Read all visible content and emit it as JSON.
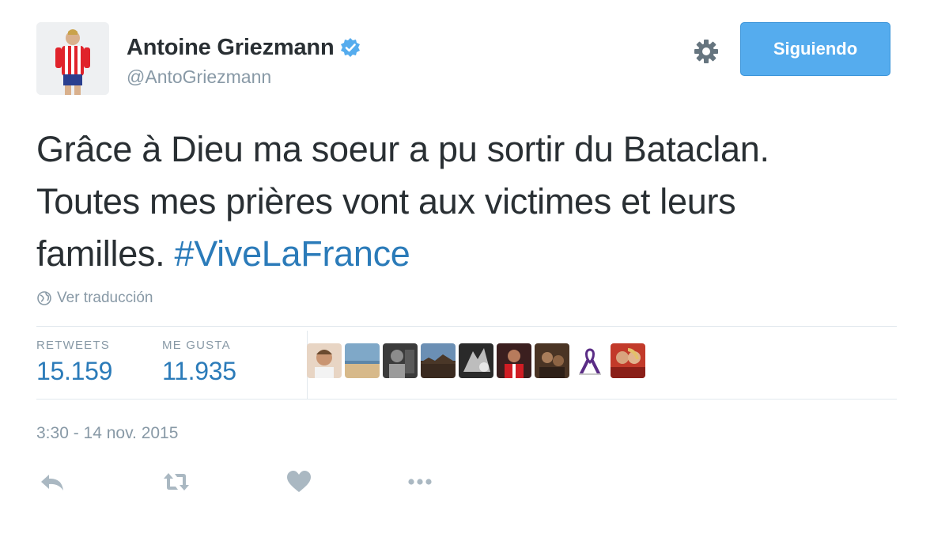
{
  "user": {
    "display_name": "Antoine Griezmann",
    "handle": "@AntoGriezmann",
    "verified": true
  },
  "header": {
    "follow_label": "Siguiendo",
    "settings_icon": "gear-icon"
  },
  "tweet": {
    "text": "Grâce à Dieu ma soeur a pu sortir du Bataclan. Toutes mes prières vont aux victimes et leurs familles.",
    "hashtag": "#ViveLaFrance",
    "translate_label": "Ver traducción",
    "timestamp": "3:30 - 14 nov. 2015"
  },
  "stats": {
    "retweets_label": "RETWEETS",
    "retweets_value": "15.159",
    "likes_label": "ME GUSTA",
    "likes_value": "11.935"
  },
  "actions": [
    "reply-icon",
    "retweet-icon",
    "like-icon",
    "more-icon"
  ],
  "colors": {
    "accent": "#55acee",
    "link": "#2b7bb9",
    "muted": "#8899a6",
    "text": "#292f33",
    "divider": "#e1e8ed"
  }
}
